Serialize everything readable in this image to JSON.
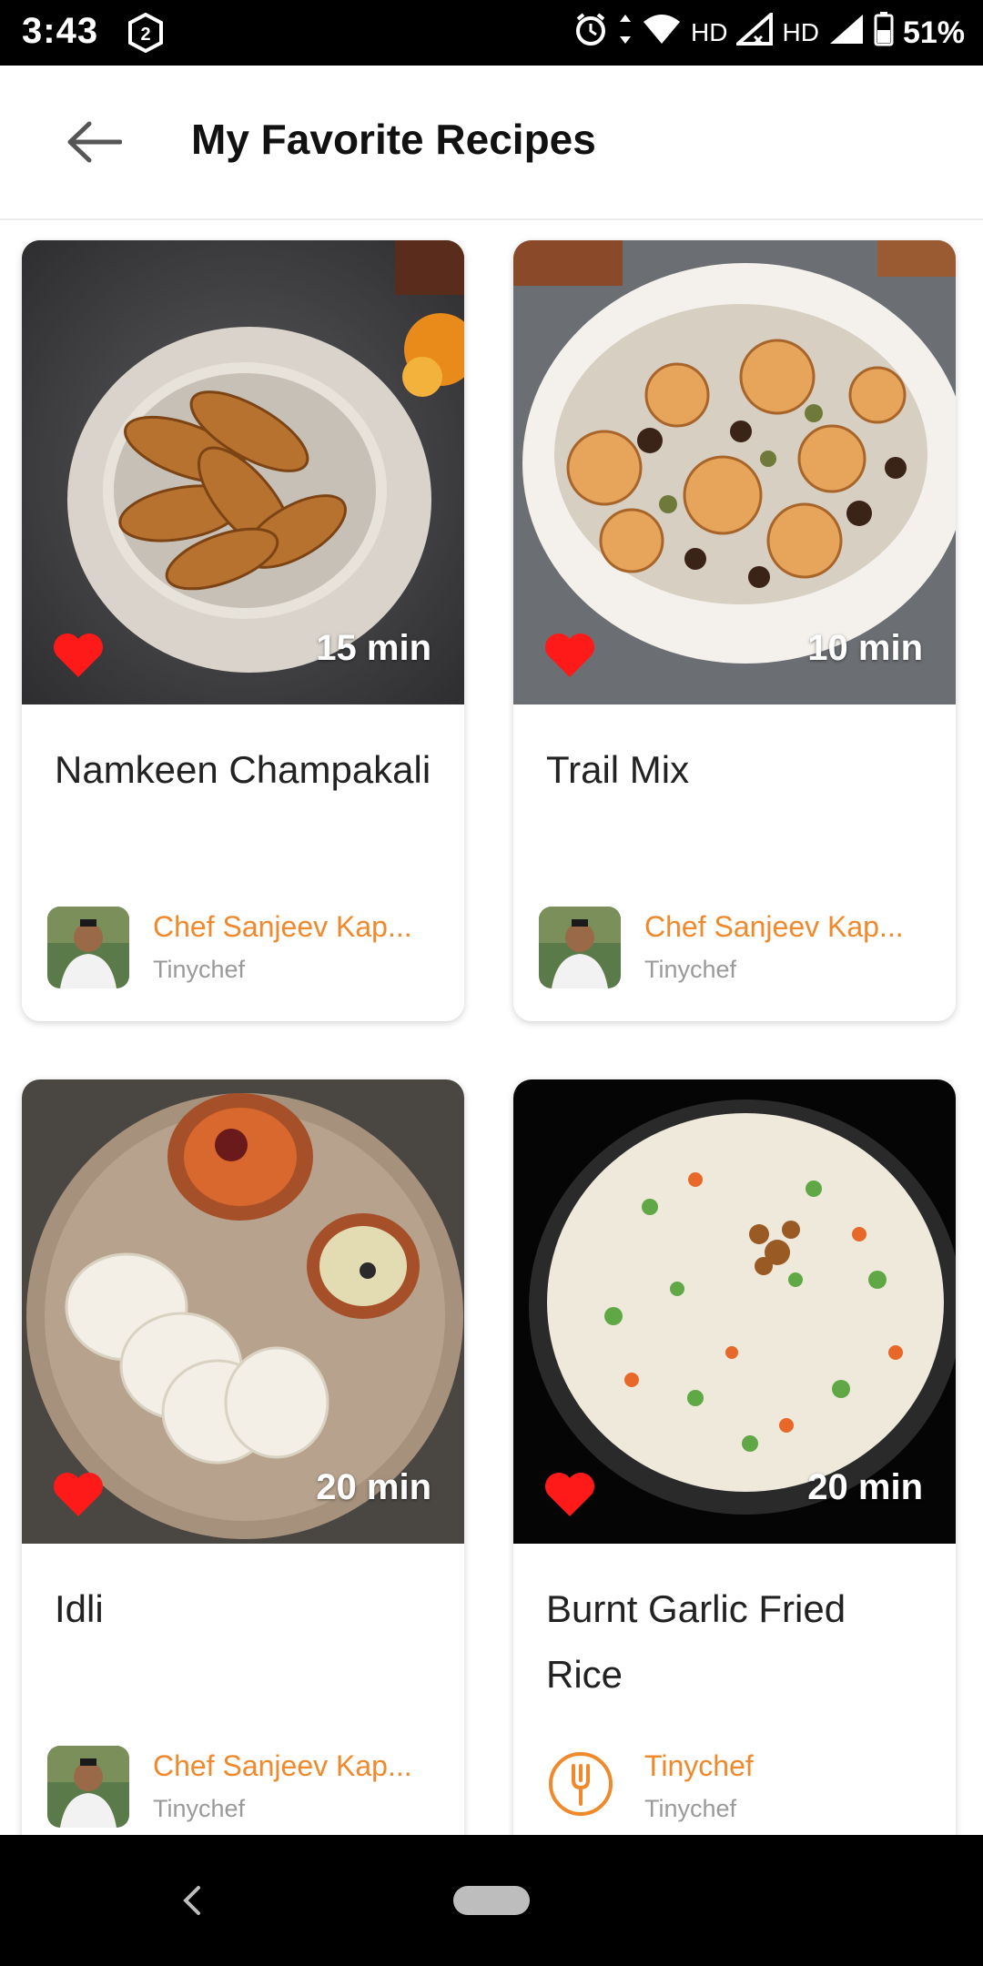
{
  "status_bar": {
    "time": "3:43",
    "badge": "2",
    "hd1": "HD",
    "hd2": "HD",
    "battery": "51%"
  },
  "header": {
    "title": "My Favorite Recipes",
    "back_icon": "arrow-left-icon"
  },
  "colors": {
    "accent": "#f0892c",
    "heart": "#ff1a1a",
    "title_text": "#222222",
    "sub_text": "#9a9a9a"
  },
  "recipes": [
    {
      "title": "Namkeen Champakali",
      "time": "15 min",
      "chef": "Chef Sanjeev Kap...",
      "source": "Tinychef",
      "favorite": true
    },
    {
      "title": "Trail Mix",
      "time": "10 min",
      "chef": "Chef Sanjeev Kap...",
      "source": "Tinychef",
      "favorite": true
    },
    {
      "title": "Idli",
      "time": "20 min",
      "chef": "Chef Sanjeev Kap...",
      "source": "Tinychef",
      "favorite": true
    },
    {
      "title": "Burnt Garlic Fried Rice",
      "time": "20 min",
      "chef": "Tinychef",
      "source": "Tinychef",
      "favorite": true
    }
  ]
}
